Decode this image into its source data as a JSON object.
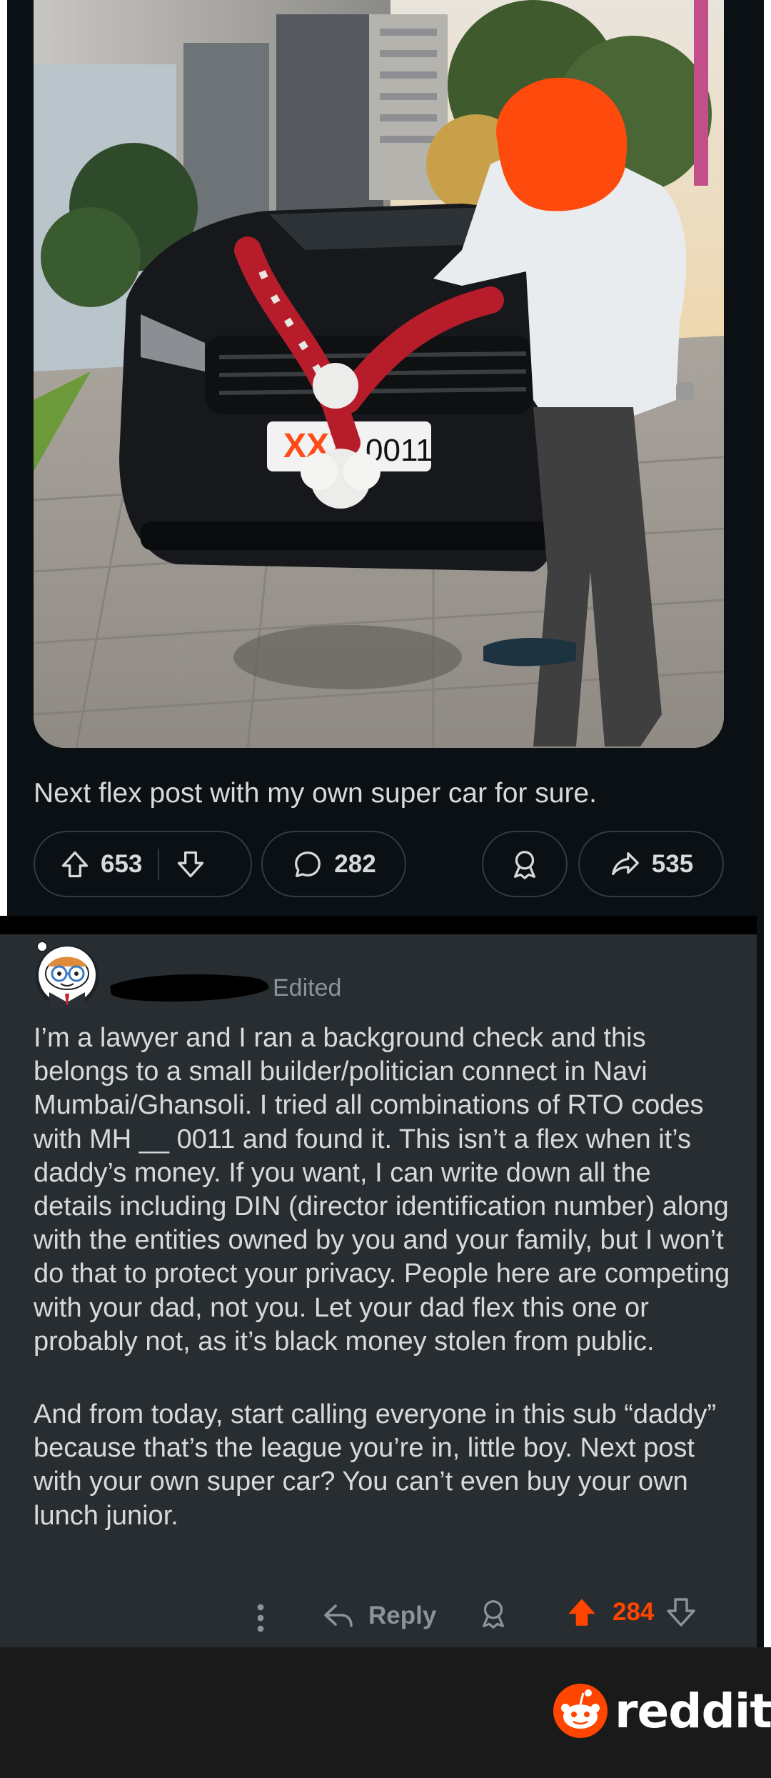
{
  "post": {
    "image_alt": "Man with face obscured standing next to a black SUV decorated with a flower garland",
    "plate_redaction": "XXX",
    "plate_text": "0011",
    "title": "Next flex post with my own super car for sure.",
    "upvotes": "653",
    "comments": "282",
    "shares": "535"
  },
  "comment": {
    "edited_label": "Edited",
    "paragraphs": [
      "I’m a lawyer and I ran a background check and this belongs to a small builder/politician connect in Navi Mumbai/Ghansoli. I tried all combinations of RTO codes with MH __ 0011 and found it. This isn’t a flex when it’s daddy’s money. If you want, I can write down all the details including DIN (director identification number) along with the entities owned by you and your family, but I won’t do that to protect your privacy. People here are competing with your dad, not you. Let your dad flex this one or probably not, as it’s black money stolen from public.",
      "And from today, start calling everyone in this sub “daddy” because that’s the league you’re in, little boy. Next post with your own super car? You can’t even buy your own lunch junior."
    ],
    "reply_label": "Reply",
    "score": "284"
  },
  "footer": {
    "brand": "reddit"
  },
  "colors": {
    "background": "#0b1014",
    "comment_background": "#272d31",
    "text": "#d7dadc",
    "muted": "#8c9499",
    "accent": "#ff4500",
    "footer": "#1a1a1b"
  },
  "icons": [
    "upvote-icon",
    "downvote-icon",
    "comment-icon",
    "award-icon",
    "share-icon",
    "more-icon",
    "reply-icon",
    "reddit-snoo-icon"
  ]
}
